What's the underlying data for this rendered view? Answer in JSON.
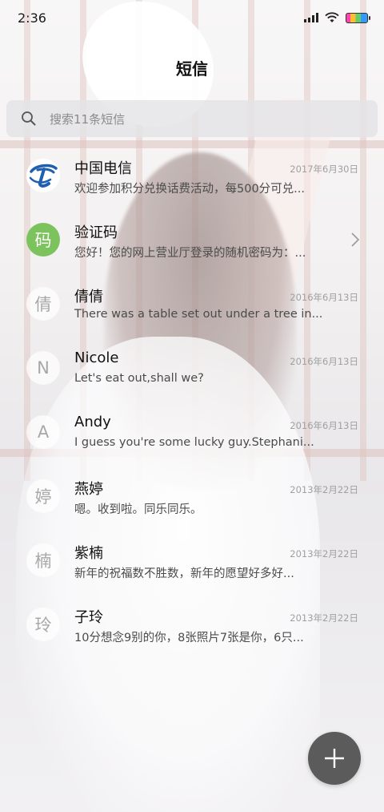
{
  "status_bar": {
    "time": "2:36"
  },
  "header": {
    "title": "短信"
  },
  "search": {
    "placeholder": "搜索11条短信"
  },
  "conversations": [
    {
      "name": "中国电信",
      "preview": "欢迎参加积分兑换话费活动，每500分可兑...",
      "date": "2017年6月30日",
      "avatar": "china-telecom-logo"
    },
    {
      "name": "验证码",
      "preview": "您好！您的网上营业厅登录的随机密码为：...",
      "date": "",
      "avatar_text": "码"
    },
    {
      "name": "倩倩",
      "preview": "There was a table set out under a tree in...",
      "date": "2016年6月13日",
      "avatar_text": "倩"
    },
    {
      "name": "Nicole",
      "preview": "Let's eat out,shall we?",
      "date": "2016年6月13日",
      "avatar_text": "N"
    },
    {
      "name": "Andy",
      "preview": "I guess you're some lucky guy.Stephani...",
      "date": "2016年6月13日",
      "avatar_text": "A"
    },
    {
      "name": "燕婷",
      "preview": "嗯。收到啦。同乐同乐。",
      "date": "2013年2月22日",
      "avatar_text": "婷"
    },
    {
      "name": "紫楠",
      "preview": "新年的祝福数不胜数，新年的愿望好多好...",
      "date": "2013年2月22日",
      "avatar_text": "楠"
    },
    {
      "name": "子玲",
      "preview": "10分想念9别的你，8张照片7张是你，6只...",
      "date": "2013年2月22日",
      "avatar_text": "玲"
    }
  ],
  "colors": {
    "fab": "#5b5b5b",
    "verify_avatar": "#7cc35e",
    "telecom_blue": "#1f5fb0"
  },
  "icons": {
    "search": "search-icon",
    "compose": "plus-icon",
    "chevron": "chevron-right-icon"
  }
}
